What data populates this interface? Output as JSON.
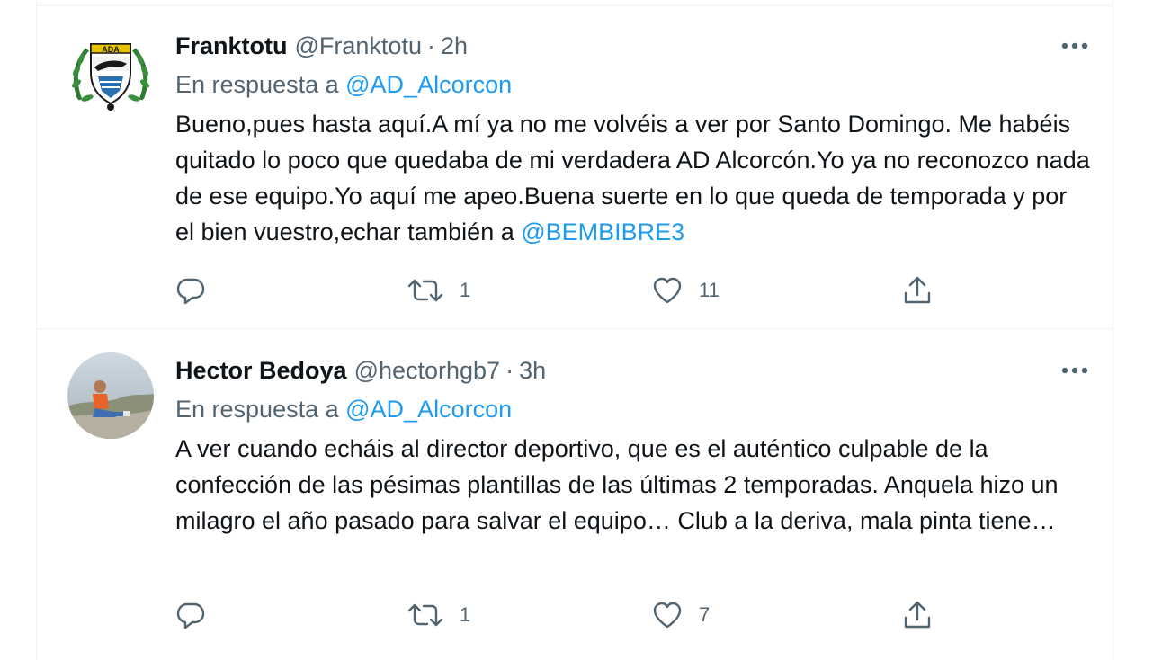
{
  "tweets": [
    {
      "name": "Franktotu",
      "handle": "@Franktotu",
      "separator": "·",
      "time": "2h",
      "reply_prefix": "En respuesta a",
      "reply_mention": "@AD_Alcorcon",
      "text": "Bueno,pues hasta aquí.A mí ya no me volvéis a ver por Santo Domingo. Me habéis quitado lo poco que quedaba de mi verdadera AD Alcorcón.Yo ya no reconozco nada de ese equipo.Yo aquí me apeo.Buena suerte en lo que queda de temporada y por el bien vuestro,echar también a ",
      "text_mention": "@BEMBIBRE3",
      "avatar_logo_text": "ADA",
      "replies": "",
      "retweets": "1",
      "likes": "11"
    },
    {
      "name": "Hector Bedoya",
      "handle": "@hectorhgb7",
      "separator": "·",
      "time": "3h",
      "reply_prefix": "En respuesta a",
      "reply_mention": "@AD_Alcorcon",
      "text": "A ver cuando echáis al director deportivo, que es el auténtico culpable de la confección de las pésimas plantillas de las últimas 2 temporadas. Anquela hizo un milagro el año pasado para salvar el equipo… Club a la deriva, mala pinta tiene…",
      "replies": "",
      "retweets": "1",
      "likes": "7"
    }
  ],
  "icons": {
    "more": "more-horizontal-icon",
    "reply": "reply-icon",
    "retweet": "retweet-icon",
    "like": "heart-icon",
    "share": "share-icon"
  },
  "colors": {
    "link": "#1d9bf0",
    "secondary_text": "#536471",
    "primary_text": "#0f1419",
    "divider": "#eff3f4"
  }
}
